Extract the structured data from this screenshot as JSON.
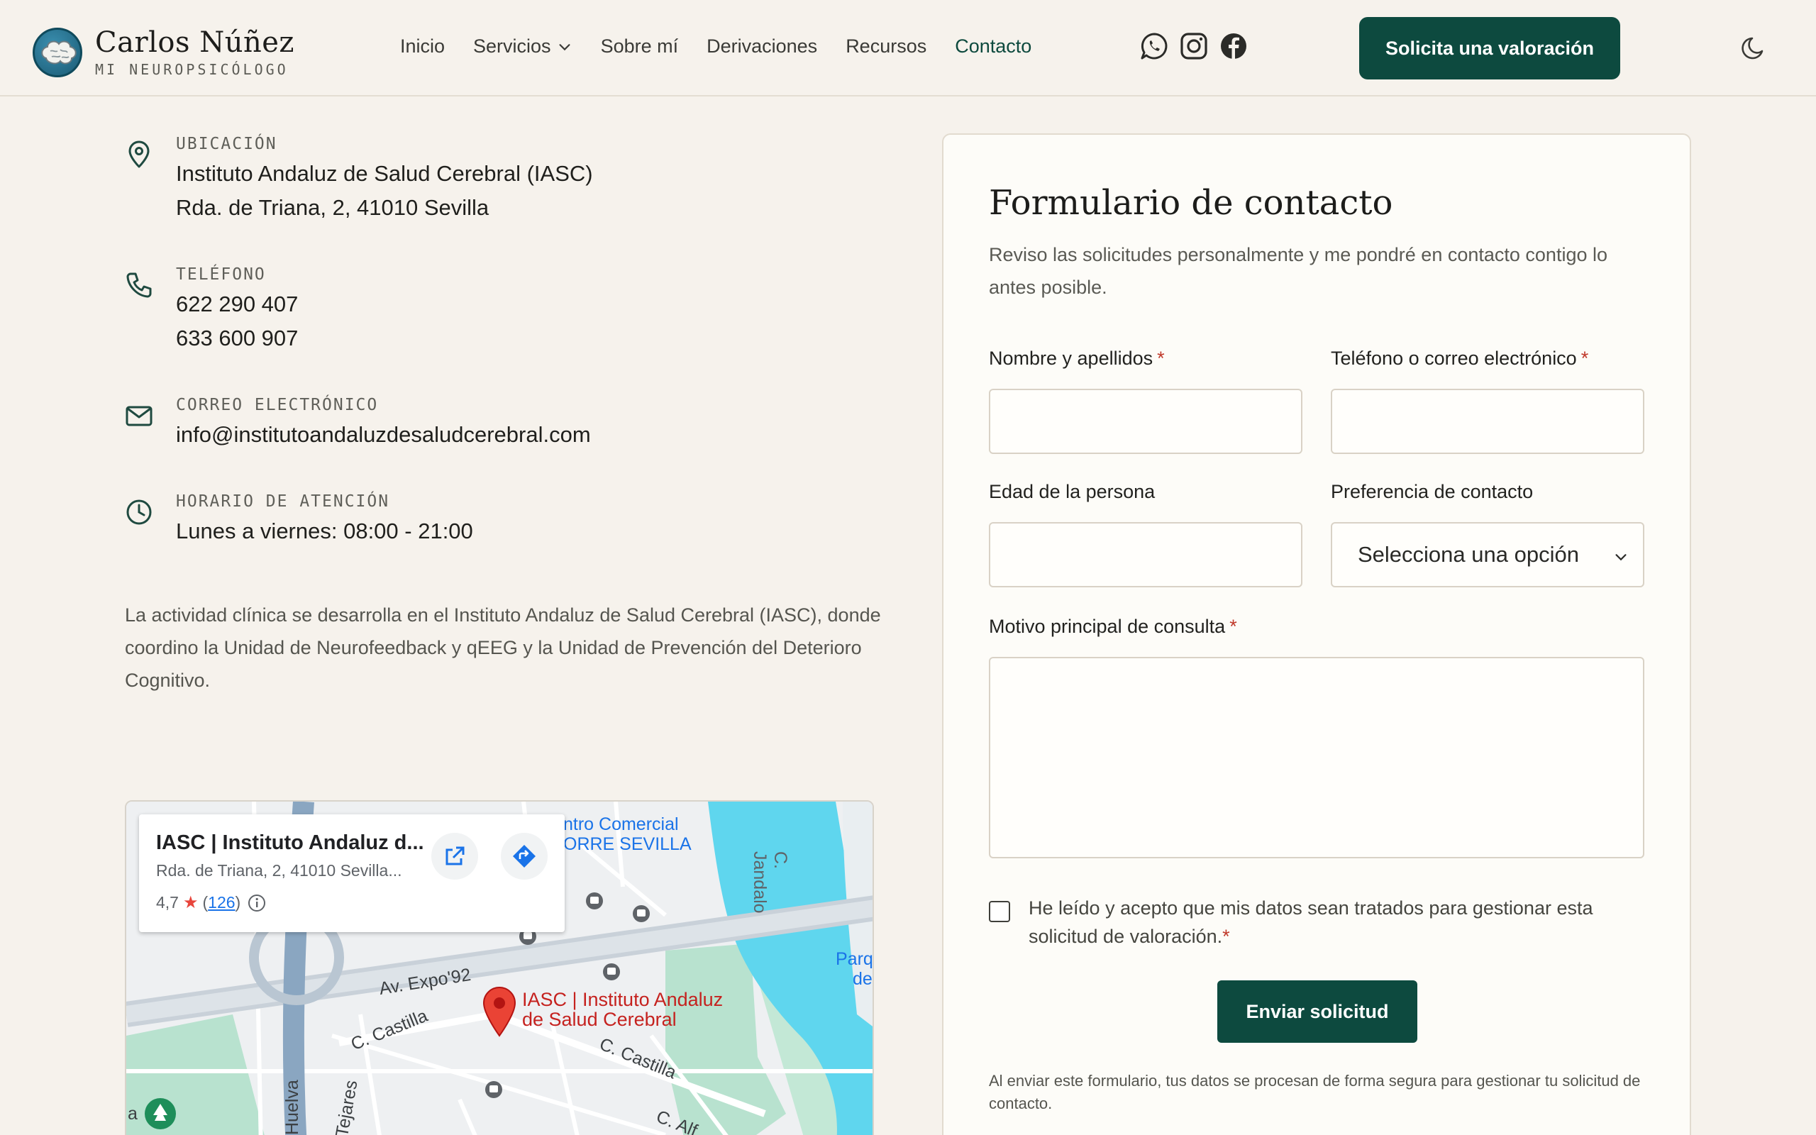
{
  "brand": {
    "name": "Carlos Núñez",
    "subtitle": "MI NEUROPSICÓLOGO"
  },
  "nav": {
    "items": [
      {
        "label": "Inicio"
      },
      {
        "label": "Servicios"
      },
      {
        "label": "Sobre mí"
      },
      {
        "label": "Derivaciones"
      },
      {
        "label": "Recursos"
      },
      {
        "label": "Contacto"
      }
    ],
    "active": "Contacto",
    "cta": "Solicita una valoración"
  },
  "socials": [
    "whatsapp-icon",
    "instagram-icon",
    "facebook-icon"
  ],
  "contact": {
    "location": {
      "label": "UBICACIÓN",
      "line1": "Instituto Andaluz de Salud Cerebral (IASC)",
      "line2": "Rda. de Triana, 2, 41010 Sevilla"
    },
    "phone": {
      "label": "TELÉFONO",
      "line1": "622 290 407",
      "line2": "633 600 907"
    },
    "email": {
      "label": "CORREO ELECTRÓNICO",
      "line1": "info@institutoandaluzdesaludcerebral.com"
    },
    "hours": {
      "label": "HORARIO DE ATENCIÓN",
      "line1": "Lunes a viernes: 08:00 - 21:00"
    },
    "intro": "La actividad clínica se desarrolla en el Instituto Andaluz de Salud Cerebral (IASC), donde coordino la Unidad de Neurofeedback y qEEG y la Unidad de Prevención del Deterioro Cognitivo."
  },
  "map": {
    "card_title": "IASC | Instituto Andaluz d...",
    "card_address": "Rda. de Triana, 2, 41010 Sevilla...",
    "rating": "4,7",
    "reviews_open": "(",
    "reviews": "126",
    "reviews_close": ")",
    "place_label_1": "IASC | Instituto Andaluz",
    "place_label_2": "de Salud Cerebral",
    "street_expo": "Av. Expo'92",
    "street_castilla_1": "C. Castilla",
    "street_castilla_2": "C. Castilla",
    "street_jandalo": "C. Jandalo",
    "street_tejares": "Tejares",
    "street_huelva": "Huelva",
    "street_alfarería": "C. Alf",
    "poi_1": "ntro Comercial",
    "poi_2": "ORRE SEVILLA",
    "park_1": "Parq",
    "park_2": "de",
    "edge_letter": "a"
  },
  "form": {
    "title": "Formulario de contacto",
    "description": "Reviso las solicitudes personalmente y me pondré en contacto contigo lo antes posible.",
    "name_label": "Nombre y apellidos",
    "contact_label": "Teléfono o correo electrónico",
    "age_label": "Edad de la persona",
    "pref_label": "Preferencia de contacto",
    "pref_value": "Selecciona una opción",
    "reason_label": "Motivo principal de consulta",
    "required_mark": "*",
    "consent": "He leído y acepto que mis datos sean tratados para gestionar esta solicitud de valoración.",
    "submit": "Enviar solicitud",
    "legal": "Al enviar este formulario, tus datos se procesan de forma segura para gestionar tu solicitud de contacto."
  },
  "colors": {
    "accent": "#0d4a3f",
    "background": "#f6f2ec",
    "required": "#c0392b"
  }
}
